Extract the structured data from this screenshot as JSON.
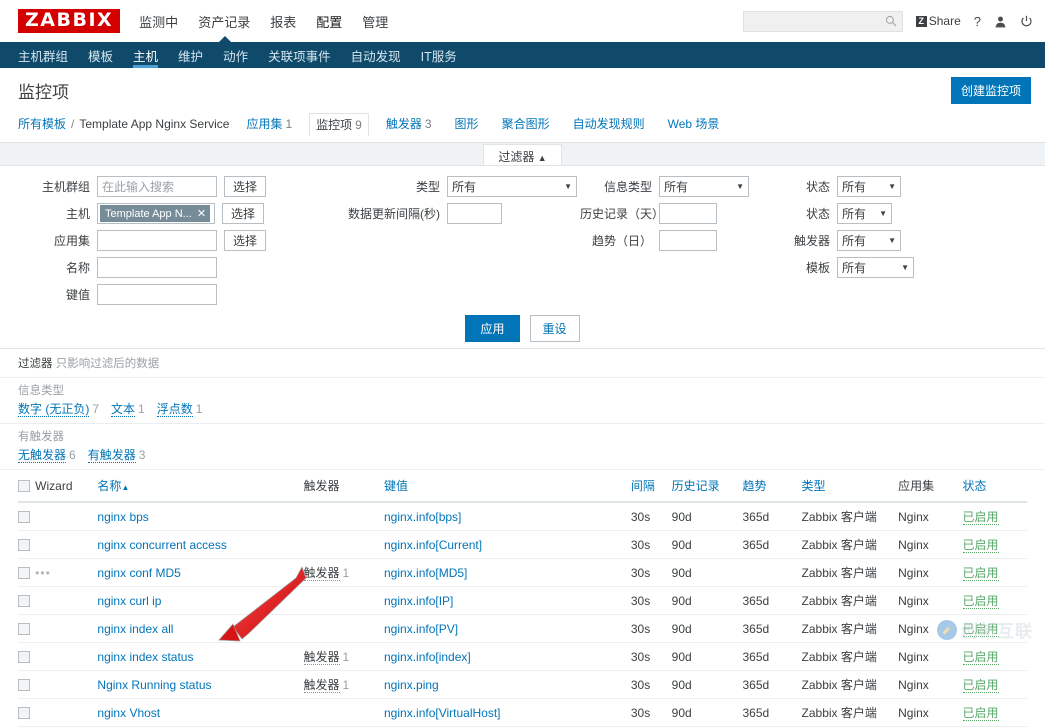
{
  "header": {
    "logo": "ZABBIX",
    "nav": [
      {
        "label": "监测中",
        "active": false
      },
      {
        "label": "资产记录",
        "active": false
      },
      {
        "label": "报表",
        "active": false
      },
      {
        "label": "配置",
        "active": true
      },
      {
        "label": "管理",
        "active": false
      }
    ],
    "search_placeholder": "",
    "search_value": "",
    "share_label": "Share",
    "share_badge": "Z",
    "help_label": "?",
    "icons": [
      "search-icon",
      "share-icon",
      "help-icon",
      "user-icon",
      "power-icon"
    ]
  },
  "subnav": [
    {
      "label": "主机群组",
      "active": false
    },
    {
      "label": "模板",
      "active": false
    },
    {
      "label": "主机",
      "active": true
    },
    {
      "label": "维护",
      "active": false
    },
    {
      "label": "动作",
      "active": false
    },
    {
      "label": "关联项事件",
      "active": false
    },
    {
      "label": "自动发现",
      "active": false
    },
    {
      "label": "IT服务",
      "active": false
    }
  ],
  "page": {
    "title": "监控项",
    "create_button": "创建监控项"
  },
  "breadcrumb": {
    "root": "所有模板",
    "separator": "/",
    "template": "Template App Nginx Service",
    "tabs": [
      {
        "label": "应用集",
        "count": "1",
        "selected": false
      },
      {
        "label": "监控项",
        "count": "9",
        "selected": true
      },
      {
        "label": "触发器",
        "count": "3",
        "selected": false
      },
      {
        "label": "图形",
        "count": "",
        "selected": false
      },
      {
        "label": "聚合图形",
        "count": "",
        "selected": false
      },
      {
        "label": "自动发现规则",
        "count": "",
        "selected": false
      },
      {
        "label": "Web 场景",
        "count": "",
        "selected": false
      }
    ]
  },
  "filter": {
    "tab_label": "过滤器",
    "tab_caret": "▲",
    "col1": [
      {
        "label": "主机群组",
        "type": "input",
        "value": "",
        "placeholder": "在此输入搜索",
        "button": "选择"
      },
      {
        "label": "主机",
        "type": "chip",
        "chip": "Template App N...",
        "button": "选择"
      },
      {
        "label": "应用集",
        "type": "input",
        "value": "",
        "placeholder": "",
        "button": "选择"
      },
      {
        "label": "名称",
        "type": "input",
        "value": "",
        "placeholder": "",
        "button": ""
      },
      {
        "label": "键值",
        "type": "input",
        "value": "",
        "placeholder": "",
        "button": ""
      }
    ],
    "col2": [
      {
        "label": "类型",
        "type": "select",
        "value": "所有"
      },
      {
        "label": "数据更新间隔(秒)",
        "type": "input",
        "value": ""
      }
    ],
    "col3": [
      {
        "label": "信息类型",
        "type": "select",
        "value": "所有"
      },
      {
        "label": "历史记录（天）",
        "type": "input",
        "value": ""
      },
      {
        "label": "趋势（日）",
        "type": "input",
        "value": ""
      }
    ],
    "col4": [
      {
        "label": "状态",
        "type": "select",
        "value": "所有"
      },
      {
        "label": "状态",
        "type": "select",
        "value": "所有"
      },
      {
        "label": "触发器",
        "type": "select",
        "value": "所有"
      },
      {
        "label": "模板",
        "type": "select",
        "value": "所有"
      }
    ],
    "apply": "应用",
    "reset": "重设"
  },
  "subfilter": {
    "note_bold": "过滤器",
    "note_rest": "只影响过滤后的数据",
    "groups": [
      {
        "title": "信息类型",
        "items": [
          {
            "label": "数字 (无正负)",
            "count": "7"
          },
          {
            "label": "文本",
            "count": "1"
          },
          {
            "label": "浮点数",
            "count": "1"
          }
        ]
      },
      {
        "title": "有触发器",
        "items": [
          {
            "label": "无触发器",
            "count": "6"
          },
          {
            "label": "有触发器",
            "count": "3"
          }
        ]
      }
    ]
  },
  "table": {
    "columns": [
      {
        "label": "Wizard",
        "link": false
      },
      {
        "label": "名称",
        "link": true,
        "sorted": "▲"
      },
      {
        "label": "触发器",
        "link": false
      },
      {
        "label": "键值",
        "link": true
      },
      {
        "label": "间隔",
        "link": true
      },
      {
        "label": "历史记录",
        "link": true
      },
      {
        "label": "趋势",
        "link": true
      },
      {
        "label": "类型",
        "link": true
      },
      {
        "label": "应用集",
        "link": false
      },
      {
        "label": "状态",
        "link": true
      }
    ],
    "rows": [
      {
        "wizard": "",
        "name": "nginx bps",
        "trigger": "",
        "trigger_count": "",
        "key": "nginx.info[bps]",
        "interval": "30s",
        "history": "90d",
        "trends": "365d",
        "type": "Zabbix 客户端",
        "app": "Nginx",
        "status": "已启用"
      },
      {
        "wizard": "",
        "name": "nginx concurrent access",
        "trigger": "",
        "trigger_count": "",
        "key": "nginx.info[Current]",
        "interval": "30s",
        "history": "90d",
        "trends": "365d",
        "type": "Zabbix 客户端",
        "app": "Nginx",
        "status": "已启用"
      },
      {
        "wizard": "•••",
        "name": "nginx conf MD5",
        "trigger": "触发器",
        "trigger_count": "1",
        "key": "nginx.info[MD5]",
        "interval": "30s",
        "history": "90d",
        "trends": "",
        "type": "Zabbix 客户端",
        "app": "Nginx",
        "status": "已启用"
      },
      {
        "wizard": "",
        "name": "nginx curl ip",
        "trigger": "",
        "trigger_count": "",
        "key": "nginx.info[IP]",
        "interval": "30s",
        "history": "90d",
        "trends": "365d",
        "type": "Zabbix 客户端",
        "app": "Nginx",
        "status": "已启用"
      },
      {
        "wizard": "",
        "name": "nginx index all",
        "trigger": "",
        "trigger_count": "",
        "key": "nginx.info[PV]",
        "interval": "30s",
        "history": "90d",
        "trends": "365d",
        "type": "Zabbix 客户端",
        "app": "Nginx",
        "status": "已启用"
      },
      {
        "wizard": "",
        "name": "nginx index status",
        "trigger": "触发器",
        "trigger_count": "1",
        "key": "nginx.info[index]",
        "interval": "30s",
        "history": "90d",
        "trends": "365d",
        "type": "Zabbix 客户端",
        "app": "Nginx",
        "status": "已启用"
      },
      {
        "wizard": "",
        "name": "Nginx Running status",
        "trigger": "触发器",
        "trigger_count": "1",
        "key": "nginx.ping",
        "interval": "30s",
        "history": "90d",
        "trends": "365d",
        "type": "Zabbix 客户端",
        "app": "Nginx",
        "status": "已启用"
      },
      {
        "wizard": "",
        "name": "nginx Vhost",
        "trigger": "",
        "trigger_count": "",
        "key": "nginx.info[VirtualHost]",
        "interval": "30s",
        "history": "90d",
        "trends": "365d",
        "type": "Zabbix 客户端",
        "app": "Nginx",
        "status": "已启用"
      }
    ]
  },
  "annotation": {
    "type": "red-arrow",
    "color": "#e01b1b",
    "points_to": "Nginx Running status"
  },
  "watermark": {
    "text": "创新互联"
  },
  "colors": {
    "brand_red": "#d40000",
    "nav_blue": "#0f4a6b",
    "link_blue": "#0275b8",
    "status_green": "#59a869"
  }
}
